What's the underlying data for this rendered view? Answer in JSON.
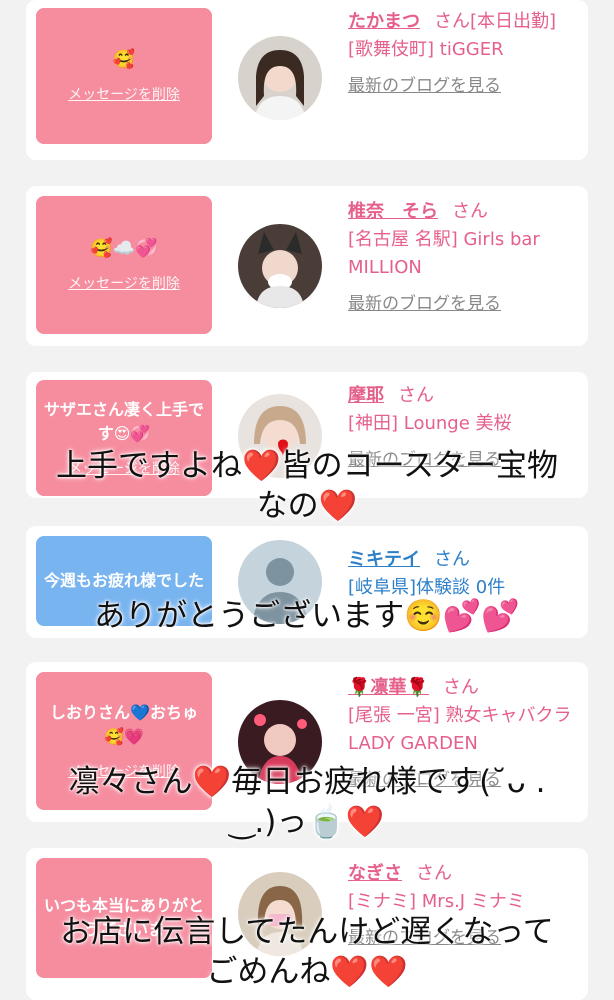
{
  "cards": [
    {
      "bubble_color": "#f58d9f",
      "bubble_text": "",
      "bubble_emoji": "🥰",
      "delete_label": "メッセージを削除",
      "name": "たかまつ",
      "san": "さん",
      "status": "[本日出勤]",
      "shop": "[歌舞伎町] tiGGER",
      "blog_label": "最新のブログを見る"
    },
    {
      "bubble_color": "#f58d9f",
      "bubble_text": "",
      "bubble_emoji": "🥰☁️💞",
      "delete_label": "メッセージを削除",
      "name": "椎奈　そら",
      "san": "さん",
      "status": "",
      "shop": "[名古屋 名駅] Girls bar MILLION",
      "blog_label": "最新のブログを見る"
    },
    {
      "bubble_color": "#f58d9f",
      "bubble_text": "サザエさん凄く上手です😍💞",
      "bubble_emoji": "",
      "delete_label": "メッセージを削除",
      "name": "摩耶",
      "san": "さん",
      "status": "",
      "shop": "[神田] Lounge 美桜",
      "blog_label": "最新のブログを見る"
    },
    {
      "bubble_color": "#78b4ef",
      "bubble_text": "今週もお疲れ様でした",
      "bubble_emoji": "",
      "delete_label": "",
      "name": "ミキテイ",
      "san": "さん",
      "status": "",
      "shop": "[岐阜県]体験談 0件",
      "blog_label": ""
    },
    {
      "bubble_color": "#f58d9f",
      "bubble_text": "しおりさん💙おちゅ🥰💗",
      "bubble_emoji": "",
      "delete_label": "メッセージを削除",
      "name": "🌹凛華🌹",
      "san": "さん",
      "status": "",
      "shop": "[尾張 一宮] 熟女キャバクラ LADY GARDEN",
      "blog_label": "最新のブログを見る"
    },
    {
      "bubble_color": "#f58d9f",
      "bubble_text": "いつも本当にありがとうございま",
      "bubble_emoji": "",
      "delete_label": "",
      "name": "なぎさ",
      "san": "さん",
      "status": "",
      "shop": "[ミナミ] Mrs.J ミナミ",
      "blog_label": "最新のブログを見る"
    }
  ],
  "captions": [
    {
      "line1": "上手ですよね❤️皆のコースター宝物",
      "line2": "なの❤️"
    },
    {
      "line1": "ありがとうございます☺️💕💕",
      "line2": ""
    },
    {
      "line1": "凛々さん❤️毎日お疲れ様です(˘ᴗ .",
      "line2": "‿.)っ🍵❤️"
    },
    {
      "line1": "お店に伝言してたんけど遅くなって",
      "line2": "ごめんね❤️❤️"
    }
  ]
}
